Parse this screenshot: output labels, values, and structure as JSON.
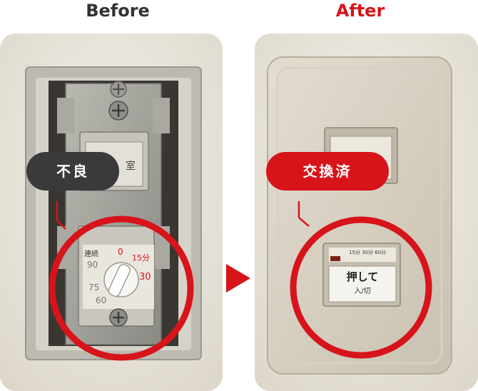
{
  "headings": {
    "before": "Before",
    "after": "After"
  },
  "tags": {
    "before": "不良",
    "after": "交換済"
  },
  "before_timer": {
    "left_top": "連続",
    "left_mid": "90",
    "left_low": "75",
    "left_bottom": "60",
    "center_top": "0",
    "right_top": "15分",
    "right_bottom": "30"
  },
  "before_switch_char": "室",
  "after_switch": {
    "marks": "15分 30分 60分",
    "label_main": "押して",
    "label_sub": "入/切"
  },
  "colors": {
    "accent": "#d7141a",
    "dark_tag": "#3a3a3a"
  }
}
